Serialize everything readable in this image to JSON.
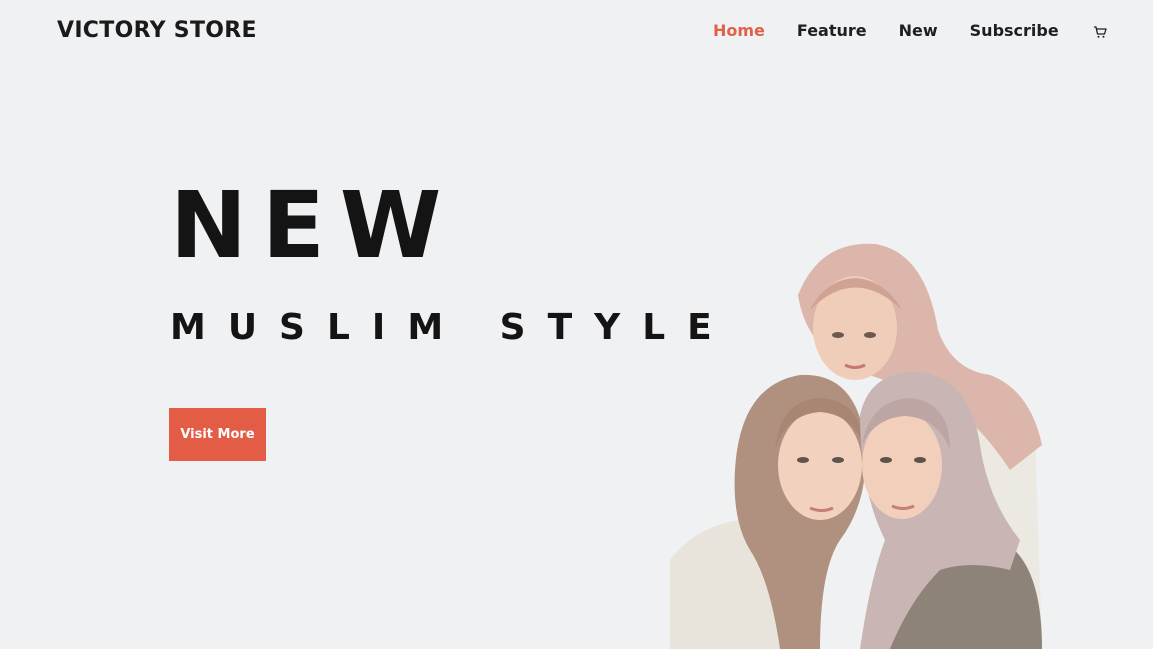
{
  "header": {
    "brand": "VICTORY STORE",
    "nav": [
      {
        "label": "Home",
        "active": true
      },
      {
        "label": "Feature",
        "active": false
      },
      {
        "label": "New",
        "active": false
      },
      {
        "label": "Subscribe",
        "active": false
      }
    ],
    "cart_icon": "cart-icon"
  },
  "hero": {
    "title": "NEW",
    "subtitle": "MUSLIM STYLE",
    "cta_label": "Visit More",
    "image_subject": "hero-photo"
  },
  "colors": {
    "accent": "#e25c46",
    "background": "#f0f1f3",
    "text": "#141414"
  }
}
